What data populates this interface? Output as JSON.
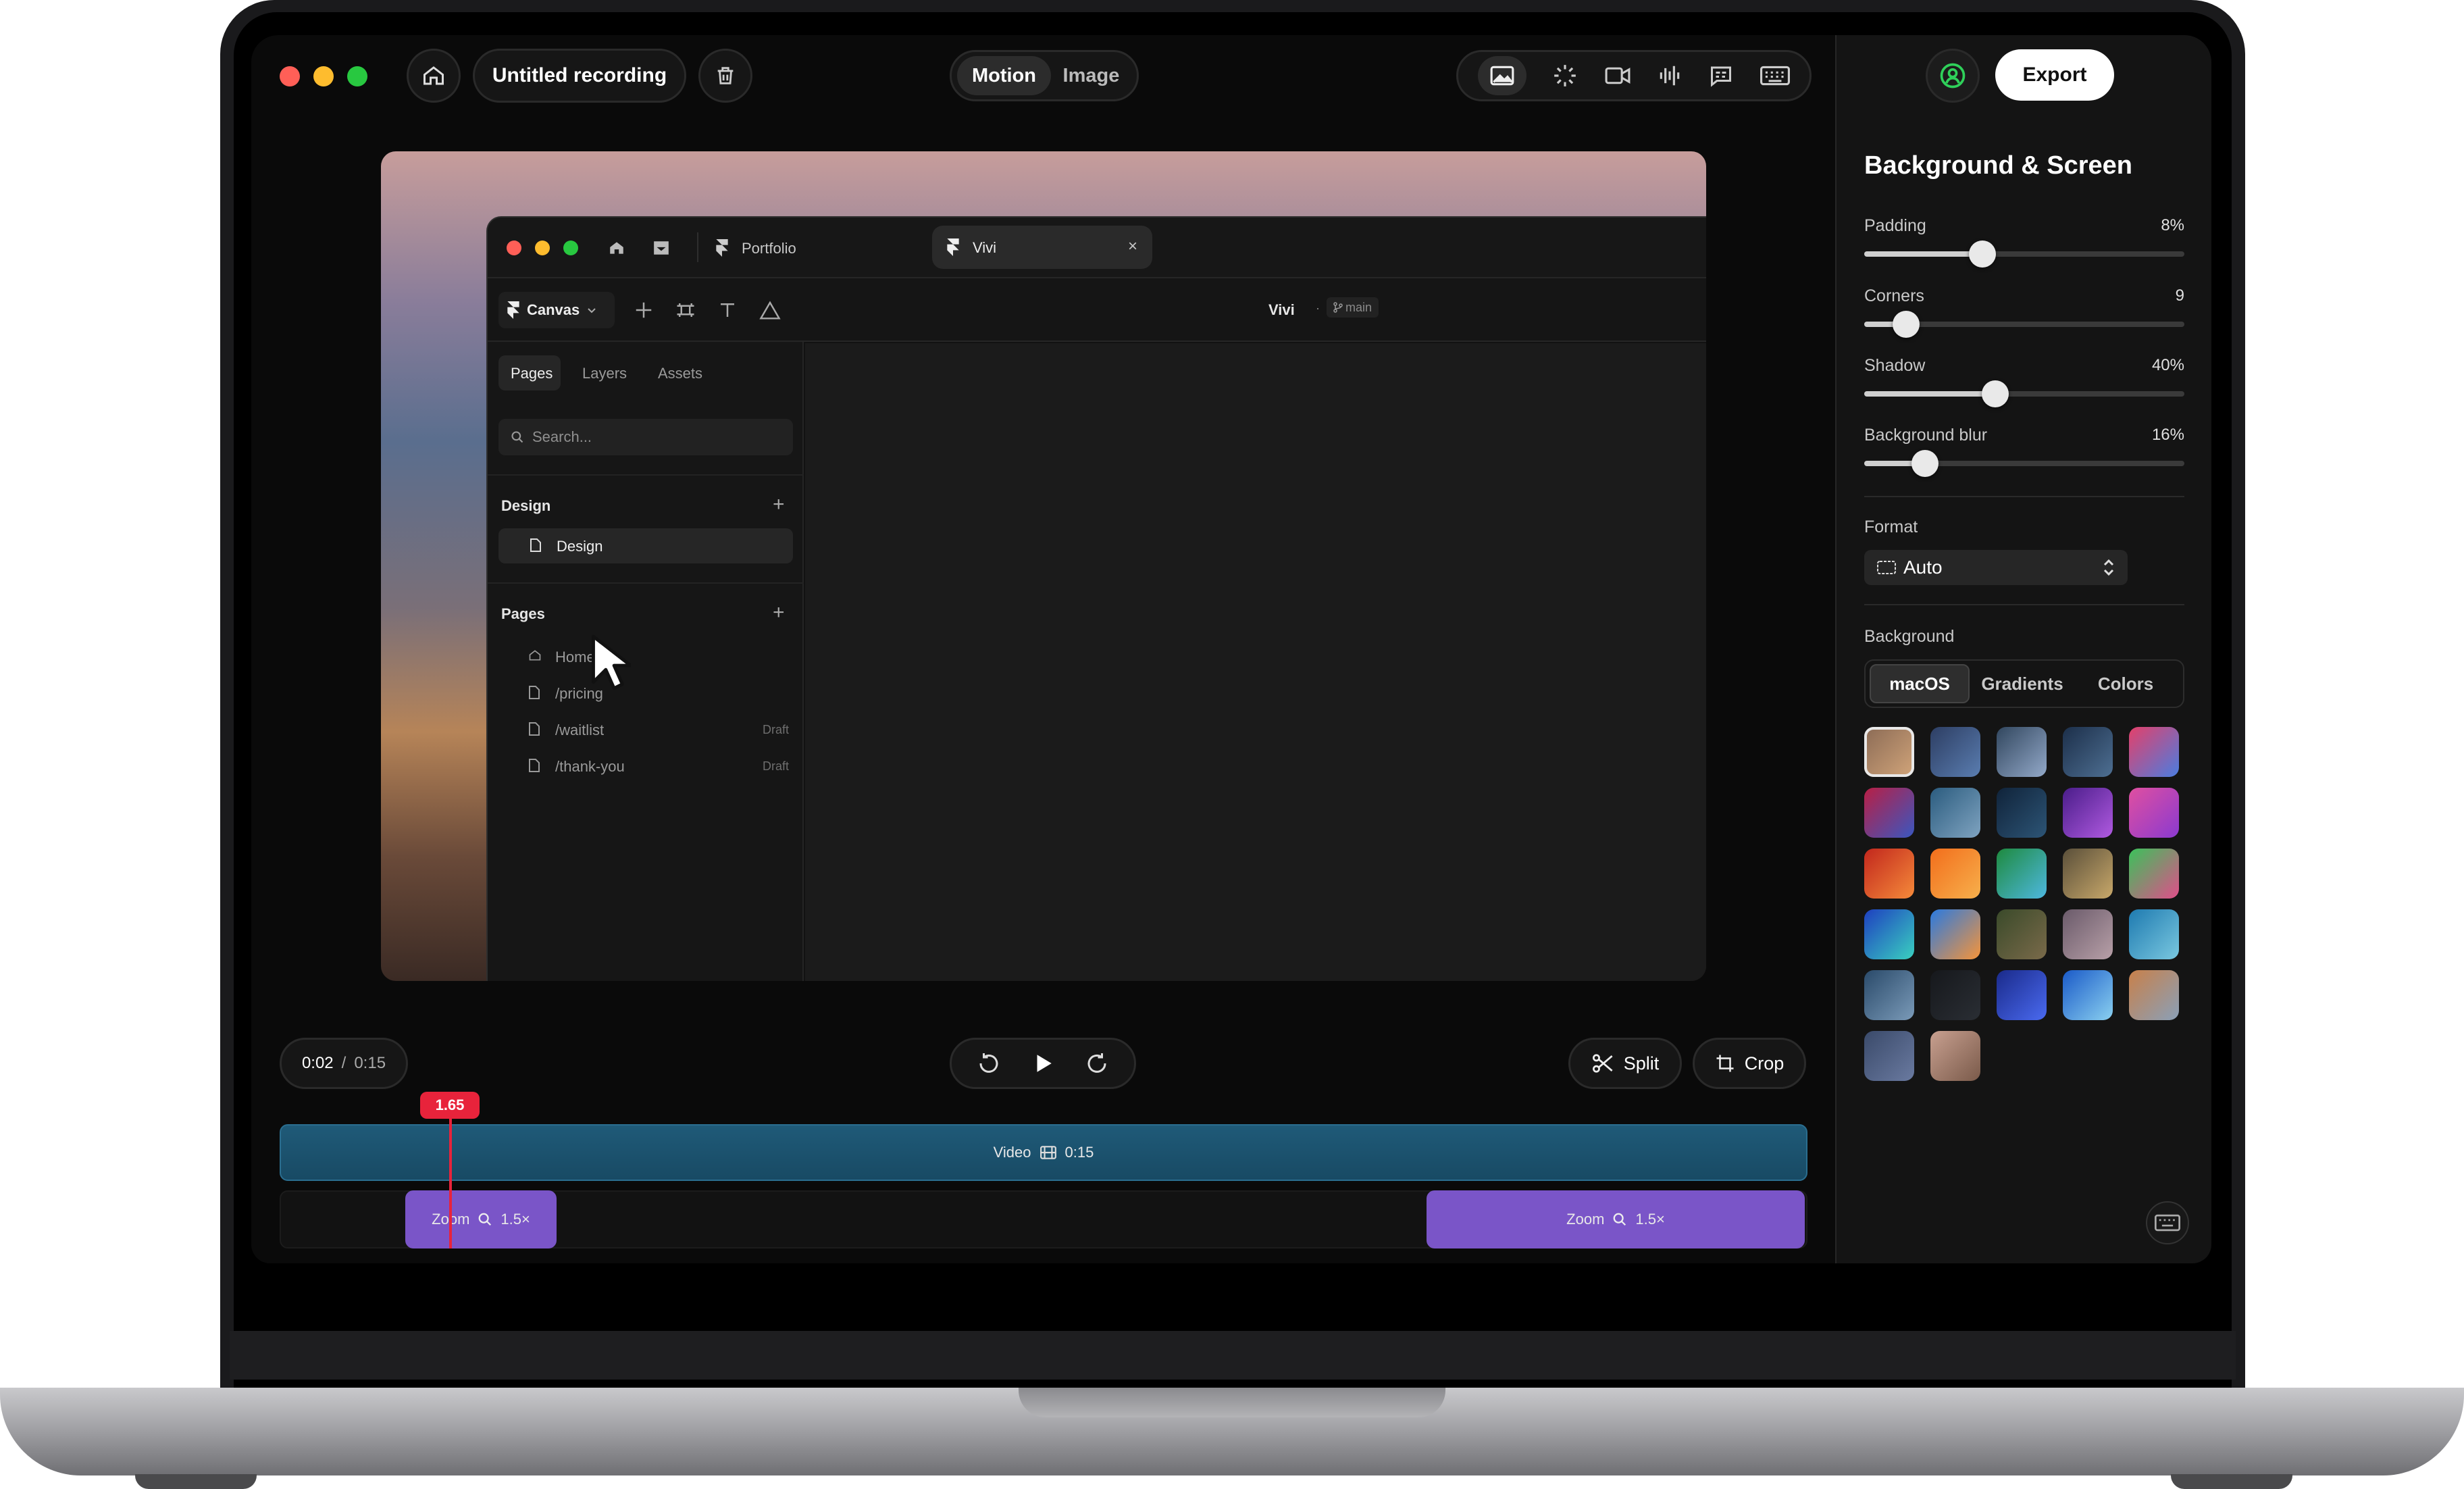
{
  "app": {
    "title": "Untitled recording",
    "mode_tabs": [
      "Motion",
      "Image"
    ],
    "export_label": "Export"
  },
  "panel": {
    "title": "Background & Screen",
    "sliders": [
      {
        "label": "Padding",
        "value_text": "8%",
        "value": 0.37
      },
      {
        "label": "Corners",
        "value_text": "9",
        "value": 0.13
      },
      {
        "label": "Shadow",
        "value_text": "40%",
        "value": 0.41
      },
      {
        "label": "Background blur",
        "value_text": "16%",
        "value": 0.19
      }
    ],
    "format_label": "Format",
    "format_value": "Auto",
    "background_label": "Background",
    "background_tabs": [
      "macOS",
      "Gradients",
      "Colors"
    ],
    "selected_background_tab": "macOS"
  },
  "wallpapers": [
    [
      "#8a6a55",
      "#d2a57a"
    ],
    [
      "#2d3e63",
      "#5a7db0"
    ],
    [
      "#31465e",
      "#93a9c9"
    ],
    [
      "#1c2f4a",
      "#4e6f92"
    ],
    [
      "#e4406a",
      "#4a7de0"
    ],
    [
      "#b81f45",
      "#3a57c0"
    ],
    [
      "#2b5c7f",
      "#7fa3c0"
    ],
    [
      "#10233a",
      "#2d5576"
    ],
    [
      "#4a1d8a",
      "#b05ae0"
    ],
    [
      "#e04fa0",
      "#8a3ad0"
    ],
    [
      "#c2271d",
      "#f58a3a"
    ],
    [
      "#f26e1c",
      "#f7b04c"
    ],
    [
      "#1e8a3e",
      "#4eb8e0"
    ],
    [
      "#5a4f3a",
      "#c8a86a"
    ],
    [
      "#3ac25a",
      "#e04e8a"
    ],
    [
      "#1e3fc0",
      "#3ad0c0"
    ],
    [
      "#2a7ae0",
      "#f5943a"
    ],
    [
      "#3a4a2a",
      "#7a6a4a"
    ],
    [
      "#6a5a6a",
      "#b8a0a8"
    ],
    [
      "#1e7ab0",
      "#7ac8e0"
    ],
    [
      "#2a4a6a",
      "#7a9ab8"
    ],
    [
      "#16181c",
      "#2a2e34"
    ],
    [
      "#1a2a8a",
      "#4a6af0"
    ],
    [
      "#1a5ac8",
      "#8ad0f0"
    ],
    [
      "#c8804a",
      "#8aa0b8"
    ],
    [
      "#3a4a6a",
      "#6a7aa0"
    ],
    [
      "#c8a090",
      "#7a5a4a"
    ]
  ],
  "playback": {
    "current_time": "0:02",
    "separator": "/",
    "total_time": "0:15",
    "split_label": "Split",
    "crop_label": "Crop",
    "playhead": "1.65"
  },
  "timeline": {
    "video_label": "Video",
    "video_duration": "0:15",
    "zoom_label": "Zoom",
    "zoom_value": "1.5×"
  },
  "recorded": {
    "tab_portfolio": "Portfolio",
    "tab_vivi": "Vivi",
    "canvas_label": "Canvas",
    "project_name": "Vivi",
    "branch": "main",
    "side_tabs": [
      "Pages",
      "Layers",
      "Assets"
    ],
    "search_placeholder": "Search...",
    "design_heading": "Design",
    "design_item": "Design",
    "pages_heading": "Pages",
    "pages": [
      {
        "name": "Home",
        "badge": ""
      },
      {
        "name": "/pricing",
        "badge": ""
      },
      {
        "name": "/waitlist",
        "badge": "Draft"
      },
      {
        "name": "/thank-you",
        "badge": "Draft"
      }
    ]
  }
}
